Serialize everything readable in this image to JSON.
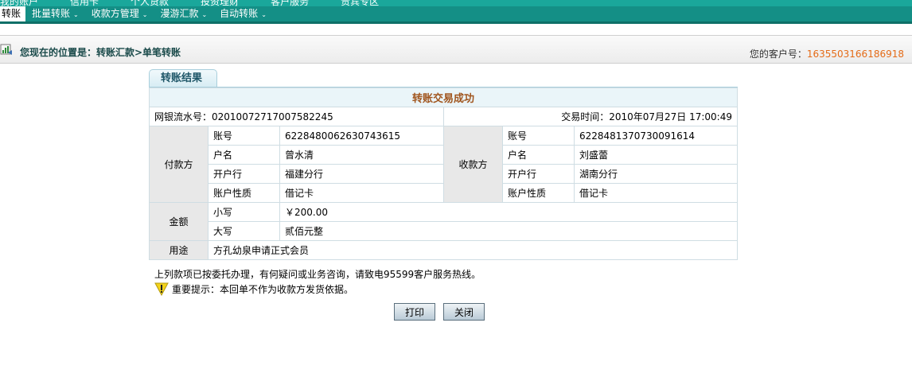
{
  "top_nav": {
    "items": [
      "我的账户",
      "信用卡",
      "个人贷款",
      "投资理财",
      "客户服务",
      "贵宾专区"
    ]
  },
  "sub_menu": {
    "items": [
      {
        "label": "转账",
        "active": true,
        "has_arrow": false
      },
      {
        "label": "批量转账",
        "active": false,
        "has_arrow": true
      },
      {
        "label": "收款方管理",
        "active": false,
        "has_arrow": true
      },
      {
        "label": "漫游汇款",
        "active": false,
        "has_arrow": true
      },
      {
        "label": "自动转账",
        "active": false,
        "has_arrow": true
      }
    ],
    "arrow_glyph": "⌄"
  },
  "location": {
    "text": "您现在的位置是：转账汇款>单笔转账",
    "customer_label": "您的客户号：",
    "customer_no": "1635503166186918"
  },
  "tab": {
    "label": "转账结果"
  },
  "result": {
    "title": "转账交易成功",
    "serial_label": "网银流水号：",
    "serial_no": "020100727170075822​45",
    "time_label": "交易时间：",
    "time_value": "2010年07月27日 17:00:49",
    "payer": {
      "group_label": "付款方",
      "account_label": "账号",
      "account": "6228480062630743615",
      "name_label": "户名",
      "name": "曾水清",
      "bank_label": "开户行",
      "bank": "福建分行",
      "type_label": "账户性质",
      "type": "借记卡"
    },
    "payee": {
      "group_label": "收款方",
      "account_label": "账号",
      "account": "6228481370730091614",
      "name_label": "户名",
      "name": "刘盛蕾",
      "bank_label": "开户行",
      "bank": "湖南分行",
      "type_label": "账户性质",
      "type": "借记卡"
    },
    "amount": {
      "group_label": "金额",
      "small_label": "小写",
      "small": "￥200.00",
      "big_label": "大写",
      "big": "贰佰元整"
    },
    "purpose": {
      "label": "用途",
      "value": "方孔幼泉申请正式会员"
    }
  },
  "notes": {
    "line1": "上列款项已按委托办理，有何疑问或业务咨询，请致电95599客户服务热线。",
    "line2": "重要提示：本回单不作为收款方发货依据。"
  },
  "buttons": {
    "print": "打印",
    "close": "关闭"
  },
  "colors": {
    "brand": "#148f86",
    "accent": "#e46b17",
    "title": "#a0551e"
  }
}
